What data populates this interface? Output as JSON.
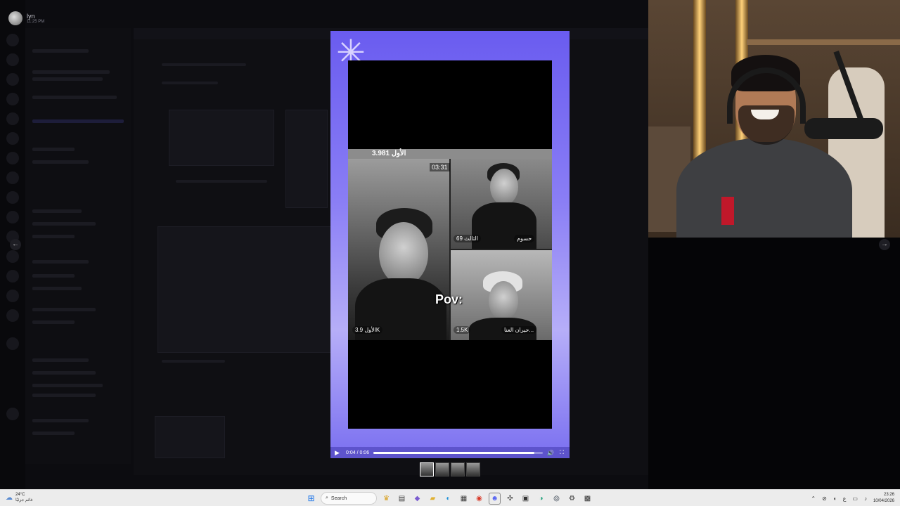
{
  "user": {
    "name": "lyn",
    "time": "11:25 PM"
  },
  "nav": {
    "prev": "←",
    "next": "→"
  },
  "video": {
    "viewer_count": "3.981 الأول",
    "timer": "03:31",
    "tile_labels": {
      "left": "الأول 3.9K",
      "top_right": "الثالث 69",
      "top_right_name": "حسوم",
      "bottom_right_count": "1.5K",
      "bottom_right_name": "حيران العنا..."
    },
    "caption": "Pov:",
    "controls": {
      "play_icon": "▶",
      "time": "0:04 / 0:06",
      "progress": 0.95,
      "volume_icon": "🔊",
      "fullscreen_icon": "⛶"
    },
    "thumbnails_count": 4,
    "active_thumbnail": 0
  },
  "taskbar": {
    "weather": {
      "temp": "24°C",
      "desc": "غائم جزئيًا",
      "icon": "cloud-sun-icon"
    },
    "search_placeholder": "Search",
    "apps": [
      "crown-icon",
      "file-manager-icon",
      "copilot-icon",
      "folder-icon",
      "edge-icon",
      "store-icon",
      "discord-icon",
      "chrome-icon",
      "steam-icon",
      "edge-dev-icon",
      "steam-icon",
      "settings-icon",
      "obs-icon"
    ],
    "tray": {
      "lang": "ع",
      "time": "23:26",
      "date": "10/04/2026"
    }
  },
  "colors": {
    "player_accent": "#6a5cf0",
    "taskbar_bg": "#ececec"
  }
}
